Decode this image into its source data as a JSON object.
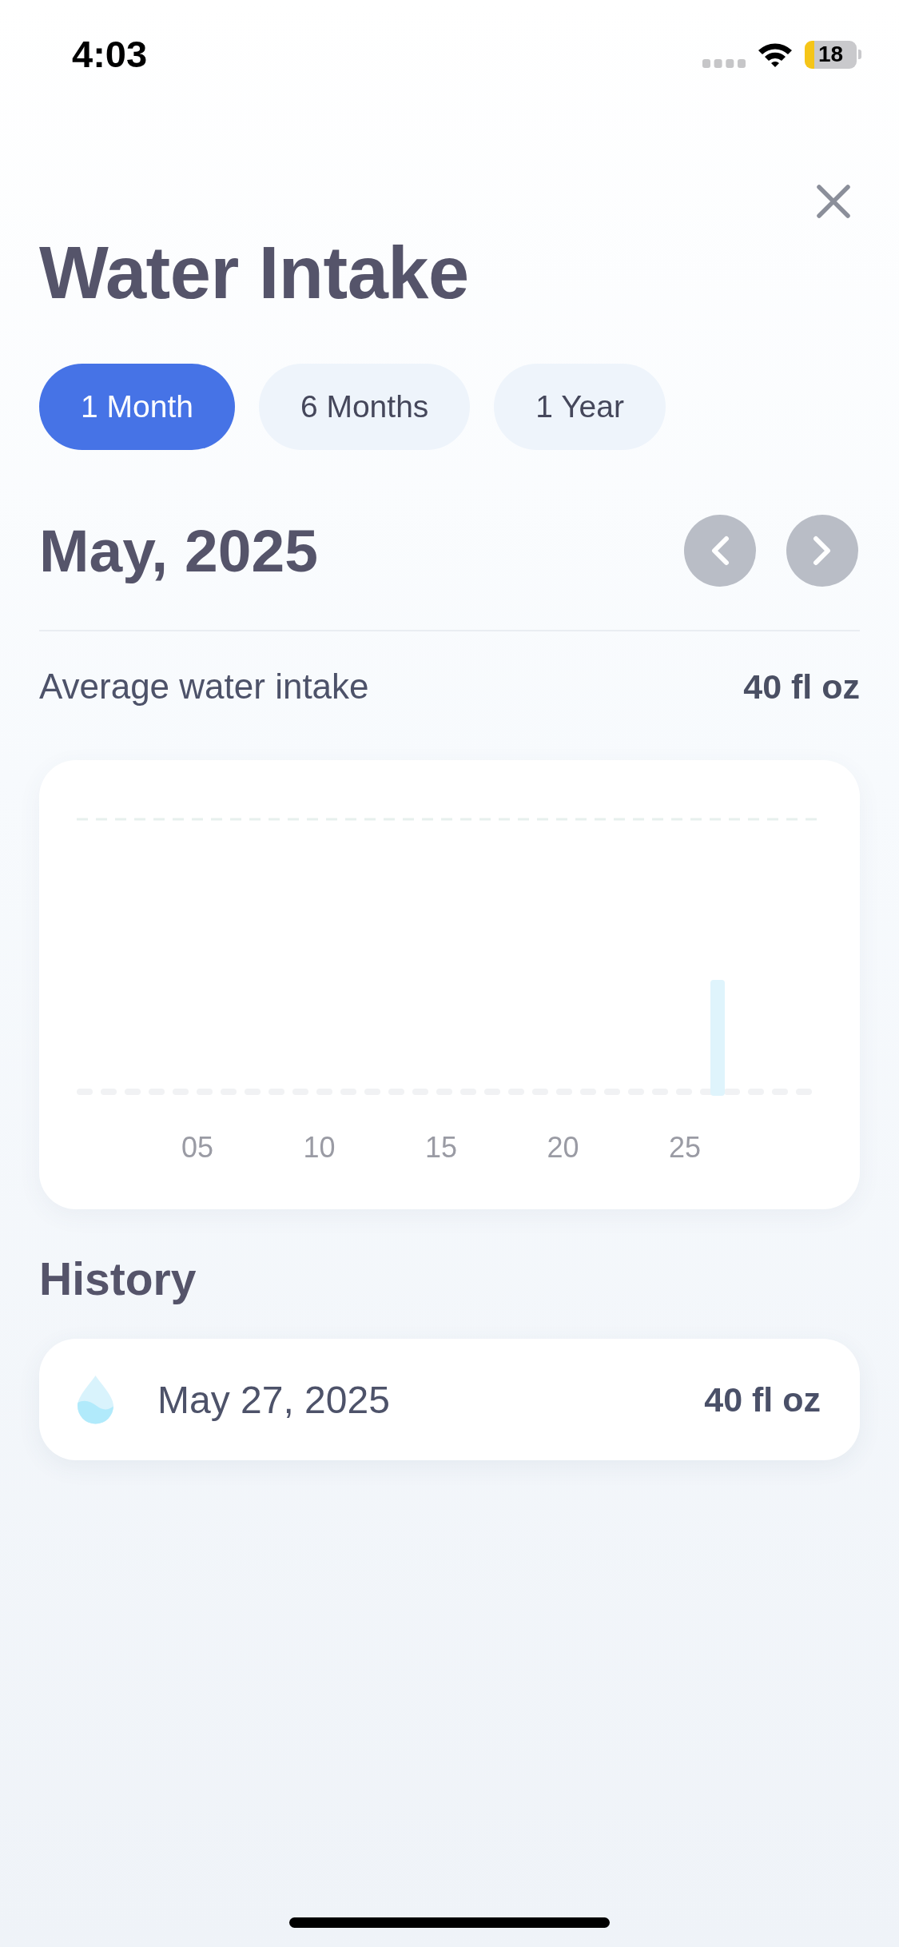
{
  "status_bar": {
    "time": "4:03",
    "battery": "18"
  },
  "title": "Water Intake",
  "tabs": [
    {
      "label": "1 Month",
      "selected": true
    },
    {
      "label": "6 Months",
      "selected": false
    },
    {
      "label": "1 Year",
      "selected": false
    }
  ],
  "period": {
    "label": "May, 2025"
  },
  "summary": {
    "label": "Average water intake",
    "value": "40 fl oz"
  },
  "chart": {
    "x_labels": [
      "05",
      "10",
      "15",
      "20",
      "25"
    ]
  },
  "history": {
    "title": "History",
    "entries": [
      {
        "date": "May 27, 2025",
        "amount": "40 fl oz"
      }
    ]
  }
}
